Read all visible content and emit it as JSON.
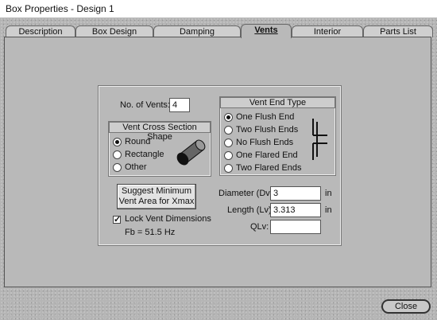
{
  "window": {
    "title": "Box Properties - Design 1"
  },
  "tabs": [
    {
      "label": "Description"
    },
    {
      "label": "Box Design"
    },
    {
      "label": "Damping"
    },
    {
      "label": "Vents"
    },
    {
      "label": "Interior"
    },
    {
      "label": "Parts List"
    }
  ],
  "active_tab": "Vents",
  "vents": {
    "num_label": "No. of Vents:",
    "num_value": "4",
    "shape_header": "Vent Cross Section Shape",
    "shapes": [
      {
        "label": "Round",
        "selected": true
      },
      {
        "label": "Rectangle",
        "selected": false
      },
      {
        "label": "Other",
        "selected": false
      }
    ],
    "suggest_button": {
      "line1": "Suggest Minimum",
      "line2": "Vent Area for Xmax"
    },
    "lock_label": "Lock Vent Dimensions",
    "lock_checked": true,
    "fb_text": "Fb = 51.5 Hz"
  },
  "end_type": {
    "header": "Vent End Type",
    "options": [
      {
        "label": "One Flush End",
        "selected": true
      },
      {
        "label": "Two Flush Ends",
        "selected": false
      },
      {
        "label": "No Flush Ends",
        "selected": false
      },
      {
        "label": "One Flared End",
        "selected": false
      },
      {
        "label": "Two Flared Ends",
        "selected": false
      }
    ]
  },
  "dimensions": {
    "diameter_label": "Diameter (Dv):",
    "diameter_value": "3",
    "diameter_unit": "in",
    "length_label": "Length (Lv):",
    "length_value": "3.313",
    "length_unit": "in",
    "qlv_label": "QLv:",
    "qlv_value": ""
  },
  "close_label": "Close"
}
